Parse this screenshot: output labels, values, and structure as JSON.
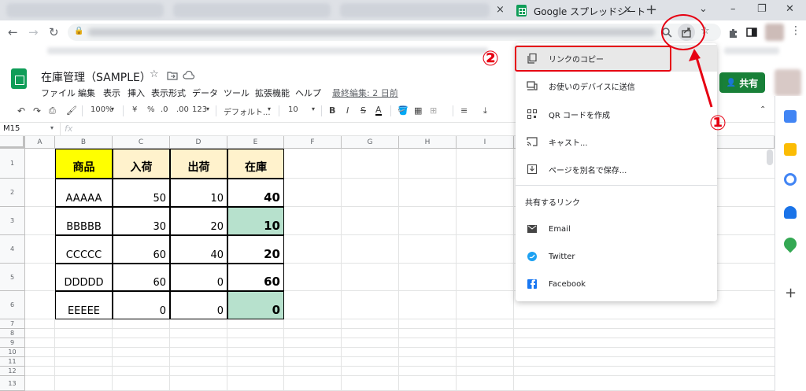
{
  "browser": {
    "tab_title": "Google スプレッドシート",
    "tab_close": "×",
    "new_tab": "+",
    "window": {
      "dropdown": "⌄",
      "minimize": "–",
      "restore": "❐",
      "close": "✕"
    },
    "nav": {
      "back": "←",
      "forward": "→",
      "reload": "↻",
      "lock": "🔒"
    }
  },
  "sheets": {
    "doc_title": "在庫管理（SAMPLE）",
    "menu": [
      "ファイル",
      "編集",
      "表示",
      "挿入",
      "表示形式",
      "データ",
      "ツール",
      "拡張機能",
      "ヘルプ"
    ],
    "last_edit": "最終編集: 2 日前",
    "share_label": "共有",
    "name_box": "M15",
    "fx": "fx",
    "toolbar": {
      "zoom": "100%",
      "currency": "¥",
      "percent": "%",
      "dec_less": ".0",
      "dec_more": ".00",
      "format": "123",
      "font": "デフォルト...",
      "size": "10",
      "bold": "B",
      "italic": "I",
      "strike": "S",
      "color": "A"
    },
    "columns": [
      "A",
      "B",
      "C",
      "D",
      "E",
      "F",
      "G",
      "H",
      "I"
    ],
    "rows": [
      "1",
      "2",
      "3",
      "4",
      "5",
      "6",
      "7",
      "8",
      "9",
      "10",
      "11",
      "12",
      "13"
    ],
    "table": {
      "headers": [
        "商品",
        "入荷",
        "出荷",
        "在庫"
      ],
      "data": [
        [
          "AAAAA",
          "50",
          "10",
          "40"
        ],
        [
          "BBBBB",
          "30",
          "20",
          "10"
        ],
        [
          "CCCCC",
          "60",
          "40",
          "20"
        ],
        [
          "DDDDD",
          "60",
          "0",
          "60"
        ],
        [
          "EEEEE",
          "0",
          "0",
          "0"
        ]
      ]
    }
  },
  "share_menu": {
    "items": [
      {
        "label": "リンクのコピー",
        "icon": "copy-icon"
      },
      {
        "label": "お使いのデバイスに送信",
        "icon": "devices-icon"
      },
      {
        "label": "QR コードを作成",
        "icon": "qr-code-icon"
      },
      {
        "label": "キャスト...",
        "icon": "cast-icon"
      },
      {
        "label": "ページを別名で保存...",
        "icon": "save-icon"
      }
    ],
    "section_title": "共有するリンク",
    "links": [
      {
        "label": "Email",
        "icon": "mail-icon"
      },
      {
        "label": "Twitter",
        "icon": "twitter-icon"
      },
      {
        "label": "Facebook",
        "icon": "facebook-icon"
      }
    ]
  },
  "annotations": {
    "step1": "①",
    "step2": "②"
  },
  "colors": {
    "annotation_red": "#e60012",
    "share_green": "#188038",
    "header_yellow": "#ffff00",
    "header_cream": "#fff2cc",
    "stock_green": "#b7e1cd"
  }
}
